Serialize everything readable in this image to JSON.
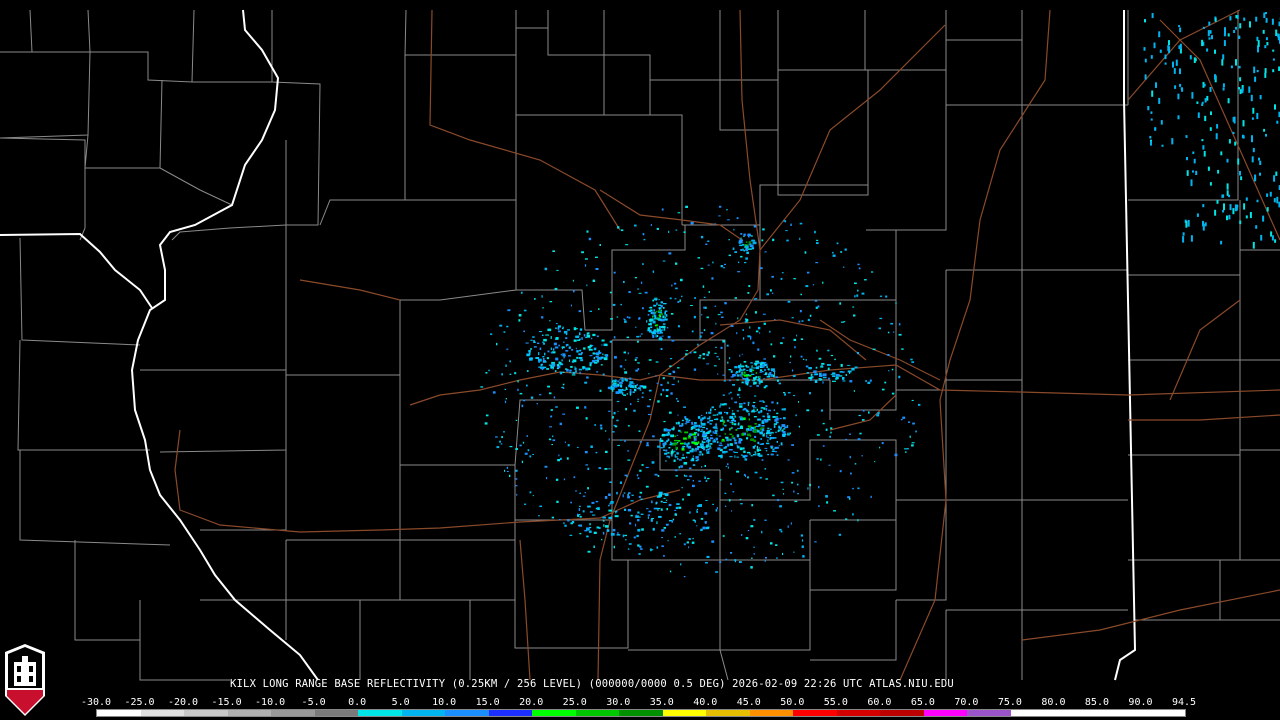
{
  "product": {
    "title": "KILX LONG RANGE BASE REFLECTIVITY (0.25KM / 256 LEVEL) (000000/0000 0.5 DEG) 2026-02-09 22:26 UTC  ATLAS.NIU.EDU"
  },
  "logo": {
    "text": "NIU",
    "color": "#c8102e"
  },
  "colors": {
    "background": "#000000",
    "county_lines": "#8a8a8a",
    "state_lines": "#ffffff",
    "roads": "#8a4a2a"
  },
  "scale": {
    "labels": [
      "-30.0",
      "-25.0",
      "-20.0",
      "-15.0",
      "-10.0",
      "-5.0",
      "0.0",
      "5.0",
      "10.0",
      "15.0",
      "20.0",
      "25.0",
      "30.0",
      "35.0",
      "40.0",
      "45.0",
      "50.0",
      "55.0",
      "60.0",
      "65.0",
      "70.0",
      "75.0",
      "80.0",
      "85.0",
      "90.0",
      "94.5"
    ],
    "colors": [
      "#ffffff",
      "#e0e0e0",
      "#c8c8c8",
      "#b0b0b0",
      "#989898",
      "#7a7a7a",
      "#00e5e5",
      "#00b4f0",
      "#1c8fff",
      "#1c2fff",
      "#00ff00",
      "#00c800",
      "#009000",
      "#ffff00",
      "#e6c000",
      "#ff9000",
      "#ff0000",
      "#d40000",
      "#bc0000",
      "#ff00ff",
      "#9955c9",
      "#ffffff",
      "#ffffff",
      "#ffffff",
      "#ffffff"
    ]
  }
}
